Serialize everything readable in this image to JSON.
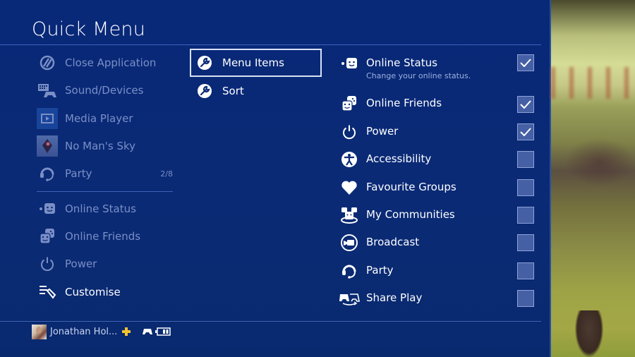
{
  "title": "Quick Menu",
  "left_menu": {
    "items": [
      {
        "label": "Close Application",
        "icon": "close-application-icon",
        "active": false
      },
      {
        "label": "Sound/Devices",
        "icon": "sound-devices-icon",
        "active": false
      },
      {
        "label": "Media Player",
        "icon": "media-player-icon",
        "active": false
      },
      {
        "label": "No Man's Sky",
        "icon": "game-thumbnail",
        "active": false
      },
      {
        "label": "Party",
        "icon": "headset-icon",
        "count": "2/8",
        "active": false
      },
      {
        "label": "Online Status",
        "icon": "online-status-icon",
        "active": false
      },
      {
        "label": "Online Friends",
        "icon": "online-friends-icon",
        "active": false
      },
      {
        "label": "Power",
        "icon": "power-icon",
        "active": false
      },
      {
        "label": "Customise",
        "icon": "customise-icon",
        "active": true
      }
    ]
  },
  "customise_menu": {
    "items": [
      {
        "label": "Menu Items",
        "icon": "wrench-icon",
        "selected": true
      },
      {
        "label": "Sort",
        "icon": "wrench-icon",
        "selected": false
      }
    ]
  },
  "menu_items": {
    "items": [
      {
        "label": "Online Status",
        "description": "Change your online status.",
        "icon": "online-status-icon",
        "checked": true
      },
      {
        "label": "Online Friends",
        "icon": "online-friends-icon",
        "checked": true
      },
      {
        "label": "Power",
        "icon": "power-icon",
        "checked": true
      },
      {
        "label": "Accessibility",
        "icon": "accessibility-icon",
        "checked": false
      },
      {
        "label": "Favourite Groups",
        "icon": "heart-icon",
        "checked": false
      },
      {
        "label": "My Communities",
        "icon": "communities-icon",
        "checked": false
      },
      {
        "label": "Broadcast",
        "icon": "broadcast-icon",
        "checked": false
      },
      {
        "label": "Party",
        "icon": "headset-icon",
        "checked": false
      },
      {
        "label": "Share Play",
        "icon": "share-play-icon",
        "checked": false
      }
    ]
  },
  "footer": {
    "username": "Jonathan Hol...",
    "plus_icon": "ps-plus-icon",
    "controller_icon": "controller-icon",
    "battery_icon": "battery-icon",
    "battery_level": "2/3"
  },
  "colors": {
    "panel_bg": "#0a2a76",
    "text_active": "#ffffff",
    "text_dim": "#7b8fc6",
    "checkbox_fill": "#4660a6",
    "plus_gold": "#f2c230"
  }
}
